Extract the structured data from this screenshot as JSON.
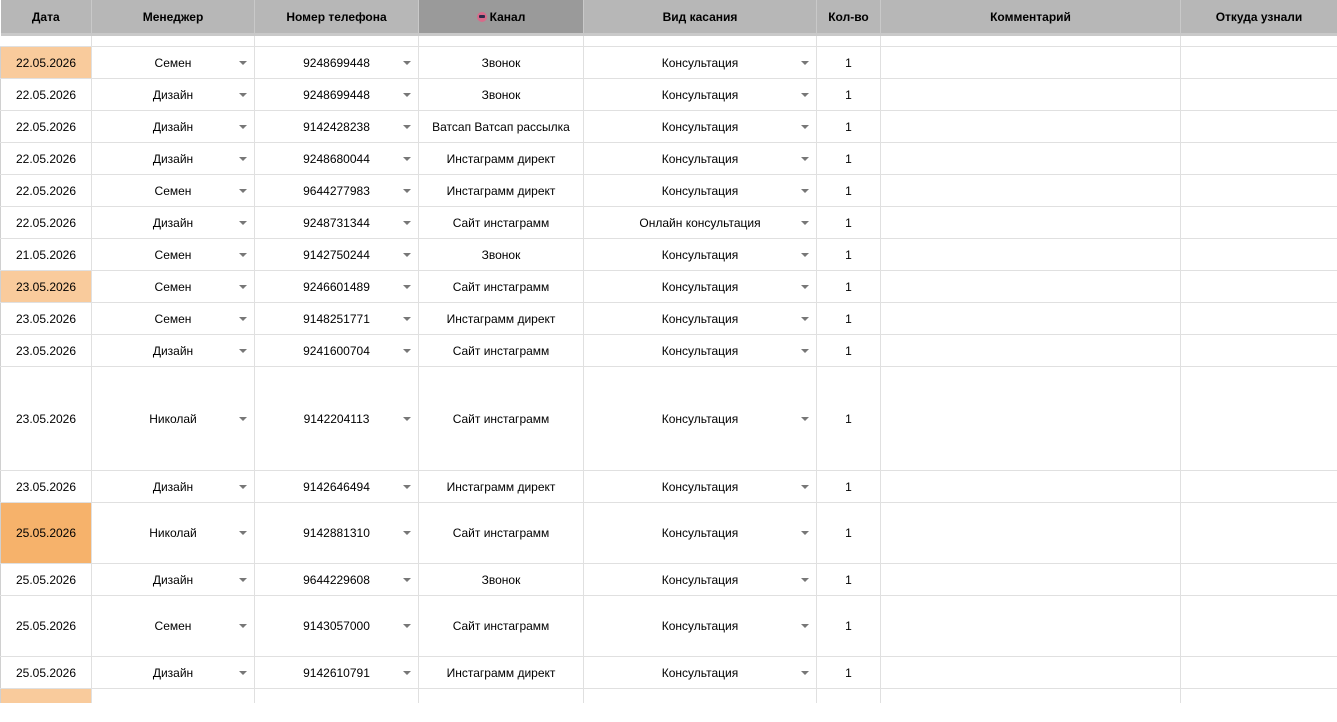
{
  "headers": {
    "date": "Дата",
    "manager": "Менеджер",
    "phone": "Номер телефона",
    "channel": "Канал",
    "contact_type": "Вид касания",
    "qty": "Кол-во",
    "comment": "Комментарий",
    "source": "Откуда узнали"
  },
  "header_icons": {
    "channel": "emoji-icon"
  },
  "colors": {
    "header_bg": "#b7b7b7",
    "header_selected_bg": "#9a9a9a",
    "date_highlight_light": "#f9cb9c",
    "date_highlight_strong": "#f6b26b"
  },
  "rows": [
    {
      "date": "22.05.2026",
      "date_highlight": "light",
      "manager": "Семен",
      "phone": "9248699448",
      "channel": "Звонок",
      "contact_type": "Консультация",
      "qty": "1"
    },
    {
      "date": "22.05.2026",
      "date_highlight": "none",
      "manager": "Дизайн",
      "phone": "9248699448",
      "channel": "Звонок",
      "contact_type": "Консультация",
      "qty": "1"
    },
    {
      "date": "22.05.2026",
      "date_highlight": "none",
      "manager": "Дизайн",
      "phone": "9142428238",
      "channel": "Ватсап Ватсап рассылка",
      "contact_type": "Консультация",
      "qty": "1"
    },
    {
      "date": "22.05.2026",
      "date_highlight": "none",
      "manager": "Дизайн",
      "phone": "9248680044",
      "channel": "Инстаграмм директ",
      "contact_type": "Консультация",
      "qty": "1"
    },
    {
      "date": "22.05.2026",
      "date_highlight": "none",
      "manager": "Семен",
      "phone": "9644277983",
      "channel": "Инстаграмм директ",
      "contact_type": "Консультация",
      "qty": "1"
    },
    {
      "date": "22.05.2026",
      "date_highlight": "none",
      "manager": "Дизайн",
      "phone": "9248731344",
      "channel": "Сайт инстаграмм",
      "contact_type": "Онлайн консультация",
      "qty": "1"
    },
    {
      "date": "21.05.2026",
      "date_highlight": "none",
      "manager": "Семен",
      "phone": "9142750244",
      "channel": "Звонок",
      "contact_type": "Консультация",
      "qty": "1"
    },
    {
      "date": "23.05.2026",
      "date_highlight": "light",
      "manager": "Семен",
      "phone": "9246601489",
      "channel": "Сайт инстаграмм",
      "contact_type": "Консультация",
      "qty": "1"
    },
    {
      "date": "23.05.2026",
      "date_highlight": "none",
      "manager": "Семен",
      "phone": "9148251771",
      "channel": "Инстаграмм директ",
      "contact_type": "Консультация",
      "qty": "1"
    },
    {
      "date": "23.05.2026",
      "date_highlight": "none",
      "manager": "Дизайн",
      "phone": "9241600704",
      "channel": "Сайт инстаграмм",
      "contact_type": "Консультация",
      "qty": "1"
    },
    {
      "date": "23.05.2026",
      "date_highlight": "none",
      "manager": "Николай",
      "phone": "9142204113",
      "channel": "Сайт инстаграмм",
      "contact_type": "Консультация",
      "qty": "1"
    },
    {
      "date": "23.05.2026",
      "date_highlight": "none",
      "manager": "Дизайн",
      "phone": "9142646494",
      "channel": "Инстаграмм директ",
      "contact_type": "Консультация",
      "qty": "1"
    },
    {
      "date": "25.05.2026",
      "date_highlight": "strong",
      "manager": "Николай",
      "phone": "9142881310",
      "channel": "Сайт инстаграмм",
      "contact_type": "Консультация",
      "qty": "1"
    },
    {
      "date": "25.05.2026",
      "date_highlight": "none",
      "manager": "Дизайн",
      "phone": "9644229608",
      "channel": "Звонок",
      "contact_type": "Консультация",
      "qty": "1"
    },
    {
      "date": "25.05.2026",
      "date_highlight": "none",
      "manager": "Семен",
      "phone": "9143057000",
      "channel": "Сайт инстаграмм",
      "contact_type": "Консультация",
      "qty": "1"
    },
    {
      "date": "25.05.2026",
      "date_highlight": "none",
      "manager": "Дизайн",
      "phone": "9142610791",
      "channel": "Инстаграмм директ",
      "contact_type": "Консультация",
      "qty": "1"
    }
  ]
}
